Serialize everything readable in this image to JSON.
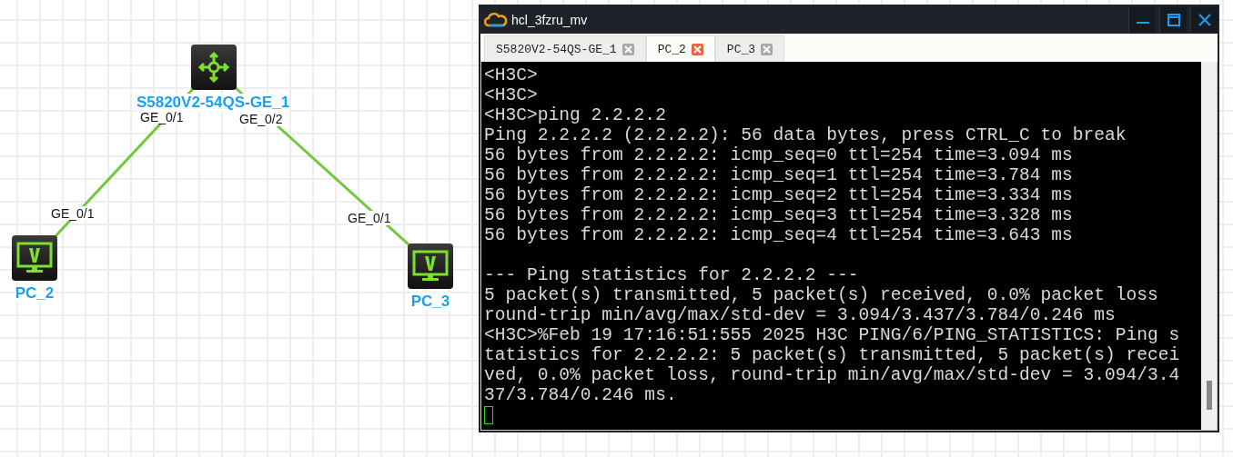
{
  "topology": {
    "nodes": [
      {
        "name": "S5820V2-54QS-GE_1",
        "kind": "switch"
      },
      {
        "name": "PC_2",
        "kind": "pc"
      },
      {
        "name": "PC_3",
        "kind": "pc"
      }
    ],
    "links": [
      {
        "from_port": "GE_0/1",
        "to_port": "GE_0/1"
      },
      {
        "from_port": "GE_0/2",
        "to_port": "GE_0/1"
      }
    ]
  },
  "window": {
    "title": "hcl_3fzru_mv"
  },
  "tabs": [
    {
      "label": "S5820V2-54QS-GE_1",
      "selected": false
    },
    {
      "label": "PC_2",
      "selected": true
    },
    {
      "label": "PC_3",
      "selected": false
    }
  ],
  "terminal": {
    "blocks": [
      [
        "<H3C>",
        "<H3C>",
        "<H3C>ping 2.2.2.2",
        "Ping 2.2.2.2 (2.2.2.2): 56 data bytes, press CTRL_C to break",
        "56 bytes from 2.2.2.2: icmp_seq=0 ttl=254 time=3.094 ms",
        "56 bytes from 2.2.2.2: icmp_seq=1 ttl=254 time=3.784 ms",
        "56 bytes from 2.2.2.2: icmp_seq=2 ttl=254 time=3.334 ms",
        "56 bytes from 2.2.2.2: icmp_seq=3 ttl=254 time=3.328 ms",
        "56 bytes from 2.2.2.2: icmp_seq=4 ttl=254 time=3.643 ms"
      ],
      [
        "--- Ping statistics for 2.2.2.2 ---",
        "5 packet(s) transmitted, 5 packet(s) received, 0.0% packet loss",
        "round-trip min/avg/max/std-dev = 3.094/3.437/3.784/0.246 ms",
        "<H3C>%Feb 19 17:16:51:555 2025 H3C PING/6/PING_STATISTICS: Ping s",
        "tatistics for 2.2.2.2: 5 packet(s) transmitted, 5 packet(s) recei",
        "ved, 0.0% packet loss, round-trip min/avg/max/std-dev = 3.094/3.4",
        "37/3.784/0.246 ms."
      ]
    ]
  }
}
